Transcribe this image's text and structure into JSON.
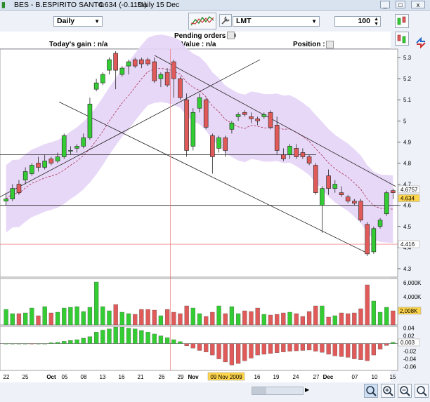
{
  "window": {
    "title": "BES - B.ESPIRITO SANTO",
    "quote": "4.634 (-0.11%)",
    "period": "Daily",
    "date": "15 Dec"
  },
  "toolbar": {
    "period_value": "Daily",
    "order_type_value": "LMT",
    "quantity_value": "100"
  },
  "info": {
    "pending_orders": "Pending orders : 0",
    "todays_gain": "Today's gain : n/a",
    "value": "Value : n/a",
    "position": "Position : 0"
  },
  "price_axis": {
    "ticks": [
      "5.3",
      "5.2",
      "5.1",
      "5",
      "4.9",
      "4.8",
      "4.7",
      "4.6",
      "4.5",
      "4.4",
      "4.3"
    ],
    "labels": {
      "upper": "4.6757",
      "last": "4.634",
      "cursor": "4.416"
    }
  },
  "volume_axis": {
    "ticks": [
      "6,000K",
      "4,000K",
      "2,000K"
    ],
    "label": "2,008K"
  },
  "macd_axis": {
    "ticks": [
      "0.04",
      "0.02",
      "0",
      "-0.02",
      "-0.04",
      "-0.06"
    ],
    "label": "0.003"
  },
  "x_axis": {
    "labels": [
      "22",
      "25",
      "Oct",
      "05",
      "08",
      "13",
      "16",
      "21",
      "26",
      "29",
      "Nov",
      "04",
      "09 Nov 2009",
      "16",
      "19",
      "24",
      "27",
      "Dec",
      "07",
      "10",
      "15"
    ]
  },
  "colors": {
    "up": "#33cc33",
    "down": "#e05a5a",
    "band": "#e6d4f7",
    "cursor": "#ee6666"
  },
  "chart_data": {
    "type": "candlestick",
    "candles": [
      {
        "o": 4.62,
        "h": 4.66,
        "l": 4.6,
        "c": 4.63
      },
      {
        "o": 4.63,
        "h": 4.7,
        "l": 4.62,
        "c": 4.68
      },
      {
        "o": 4.7,
        "h": 4.72,
        "l": 4.65,
        "c": 4.66
      },
      {
        "o": 4.72,
        "h": 4.78,
        "l": 4.7,
        "c": 4.76
      },
      {
        "o": 4.75,
        "h": 4.8,
        "l": 4.74,
        "c": 4.79
      },
      {
        "o": 4.8,
        "h": 4.83,
        "l": 4.76,
        "c": 4.78
      },
      {
        "o": 4.78,
        "h": 4.84,
        "l": 4.77,
        "c": 4.81
      },
      {
        "o": 4.82,
        "h": 4.83,
        "l": 4.79,
        "c": 4.8
      },
      {
        "o": 4.81,
        "h": 4.85,
        "l": 4.8,
        "c": 4.83
      },
      {
        "o": 4.83,
        "h": 4.94,
        "l": 4.82,
        "c": 4.93
      },
      {
        "o": 4.86,
        "h": 4.88,
        "l": 4.84,
        "c": 4.86
      },
      {
        "o": 4.87,
        "h": 4.89,
        "l": 4.85,
        "c": 4.88
      },
      {
        "o": 4.88,
        "h": 4.94,
        "l": 4.87,
        "c": 4.92
      },
      {
        "o": 4.92,
        "h": 5.11,
        "l": 4.91,
        "c": 5.08
      },
      {
        "o": 5.15,
        "h": 5.2,
        "l": 5.14,
        "c": 5.18
      },
      {
        "o": 5.18,
        "h": 5.23,
        "l": 5.17,
        "c": 5.22
      },
      {
        "o": 5.24,
        "h": 5.3,
        "l": 5.22,
        "c": 5.29
      },
      {
        "o": 5.32,
        "h": 5.33,
        "l": 5.15,
        "c": 5.24
      },
      {
        "o": 5.22,
        "h": 5.26,
        "l": 5.21,
        "c": 5.25
      },
      {
        "o": 5.26,
        "h": 5.29,
        "l": 5.22,
        "c": 5.28
      },
      {
        "o": 5.29,
        "h": 5.3,
        "l": 5.25,
        "c": 5.26
      },
      {
        "o": 5.29,
        "h": 5.3,
        "l": 5.25,
        "c": 5.27
      },
      {
        "o": 5.29,
        "h": 5.3,
        "l": 5.26,
        "c": 5.27
      },
      {
        "o": 5.28,
        "h": 5.3,
        "l": 5.18,
        "c": 5.19
      },
      {
        "o": 5.2,
        "h": 5.23,
        "l": 5.16,
        "c": 5.22
      },
      {
        "o": 5.23,
        "h": 5.25,
        "l": 5.16,
        "c": 5.17
      },
      {
        "o": 5.28,
        "h": 5.29,
        "l": 5.11,
        "c": 5.2
      },
      {
        "o": 5.2,
        "h": 5.21,
        "l": 5.1,
        "c": 5.11
      },
      {
        "o": 5.1,
        "h": 5.13,
        "l": 4.83,
        "c": 4.86
      },
      {
        "o": 4.88,
        "h": 5.06,
        "l": 4.86,
        "c": 5.04
      },
      {
        "o": 5.06,
        "h": 5.13,
        "l": 5.04,
        "c": 5.11
      },
      {
        "o": 5.1,
        "h": 5.11,
        "l": 4.96,
        "c": 4.97
      },
      {
        "o": 4.93,
        "h": 4.94,
        "l": 4.75,
        "c": 4.83
      },
      {
        "o": 4.87,
        "h": 4.93,
        "l": 4.85,
        "c": 4.92
      },
      {
        "o": 4.92,
        "h": 4.93,
        "l": 4.83,
        "c": 4.86
      },
      {
        "o": 4.96,
        "h": 5,
        "l": 4.94,
        "c": 4.99
      },
      {
        "o": 5.02,
        "h": 5.04,
        "l": 5,
        "c": 5.03
      },
      {
        "o": 5.04,
        "h": 5.05,
        "l": 5.02,
        "c": 5.03
      },
      {
        "o": 5.02,
        "h": 5.04,
        "l": 4.99,
        "c": 5.01
      },
      {
        "o": 5.01,
        "h": 5.02,
        "l": 4.98,
        "c": 5
      },
      {
        "o": 5.02,
        "h": 5.04,
        "l": 5.01,
        "c": 5.03
      },
      {
        "o": 5.04,
        "h": 5.05,
        "l": 4.96,
        "c": 4.97
      },
      {
        "o": 4.98,
        "h": 5.02,
        "l": 4.84,
        "c": 4.86
      },
      {
        "o": 4.84,
        "h": 4.87,
        "l": 4.81,
        "c": 4.82
      },
      {
        "o": 4.84,
        "h": 4.89,
        "l": 4.82,
        "c": 4.88
      },
      {
        "o": 4.87,
        "h": 4.89,
        "l": 4.82,
        "c": 4.83
      },
      {
        "o": 4.85,
        "h": 4.87,
        "l": 4.82,
        "c": 4.83
      },
      {
        "o": 4.83,
        "h": 4.84,
        "l": 4.79,
        "c": 4.8
      },
      {
        "o": 4.79,
        "h": 4.8,
        "l": 4.65,
        "c": 4.66
      },
      {
        "o": 4.6,
        "h": 4.69,
        "l": 4.47,
        "c": 4.68
      },
      {
        "o": 4.74,
        "h": 4.77,
        "l": 4.65,
        "c": 4.68
      },
      {
        "o": 4.68,
        "h": 4.72,
        "l": 4.66,
        "c": 4.7
      },
      {
        "o": 4.66,
        "h": 4.69,
        "l": 4.64,
        "c": 4.65
      },
      {
        "o": 4.64,
        "h": 4.65,
        "l": 4.61,
        "c": 4.62
      },
      {
        "o": 4.62,
        "h": 4.63,
        "l": 4.6,
        "c": 4.61
      },
      {
        "o": 4.62,
        "h": 4.63,
        "l": 4.52,
        "c": 4.53
      },
      {
        "o": 4.51,
        "h": 4.52,
        "l": 4.36,
        "c": 4.37
      },
      {
        "o": 4.38,
        "h": 4.5,
        "l": 4.37,
        "c": 4.49
      },
      {
        "o": 4.5,
        "h": 4.54,
        "l": 4.49,
        "c": 4.53
      },
      {
        "o": 4.56,
        "h": 4.67,
        "l": 4.55,
        "c": 4.66
      },
      {
        "o": 4.67,
        "h": 4.68,
        "l": 4.63,
        "c": 4.66
      }
    ],
    "volume": [
      2.2,
      1.6,
      1.6,
      1.7,
      2.4,
      1.3,
      2.6,
      1.7,
      1.8,
      2.4,
      2.5,
      2.6,
      1.9,
      2.5,
      6.1,
      2.6,
      2.0,
      2.9,
      1.8,
      1.6,
      1.5,
      2.2,
      2.2,
      2.1,
      1.3,
      2.2,
      1.8,
      1.6,
      2.7,
      2.4,
      1.6,
      1.2,
      1.8,
      2.7,
      1.6,
      2.6,
      1.6,
      2.0,
      1.9,
      2.4,
      1.5,
      1.4,
      1.5,
      1.7,
      1.8,
      1.6,
      1.2,
      1.9,
      2.7,
      2.7,
      1.1,
      1.3,
      1.7,
      1.6,
      1.7,
      2.3,
      5.7,
      3.4,
      1.8,
      2.5,
      2.0
    ],
    "macd": [
      0,
      0,
      0,
      0,
      -0.001,
      0,
      0,
      0.002,
      0.003,
      0.006,
      0.008,
      0.01,
      0.014,
      0.018,
      0.03,
      0.035,
      0.038,
      0.043,
      0.043,
      0.04,
      0.038,
      0.034,
      0.03,
      0.025,
      0.02,
      0.015,
      0.01,
      0.005,
      -0.006,
      -0.012,
      -0.018,
      -0.022,
      -0.03,
      -0.04,
      -0.048,
      -0.056,
      -0.052,
      -0.045,
      -0.038,
      -0.03,
      -0.028,
      -0.026,
      -0.024,
      -0.022,
      -0.02,
      -0.019,
      -0.018,
      -0.017,
      -0.02,
      -0.023,
      -0.028,
      -0.032,
      -0.034,
      -0.036,
      -0.04,
      -0.042,
      -0.045,
      -0.03,
      -0.015,
      -0.005,
      0.003
    ],
    "yrange_price": [
      4.26,
      5.34
    ],
    "yrange_volume": [
      0,
      6.6
    ],
    "yrange_macd": [
      -0.07,
      0.045
    ]
  }
}
